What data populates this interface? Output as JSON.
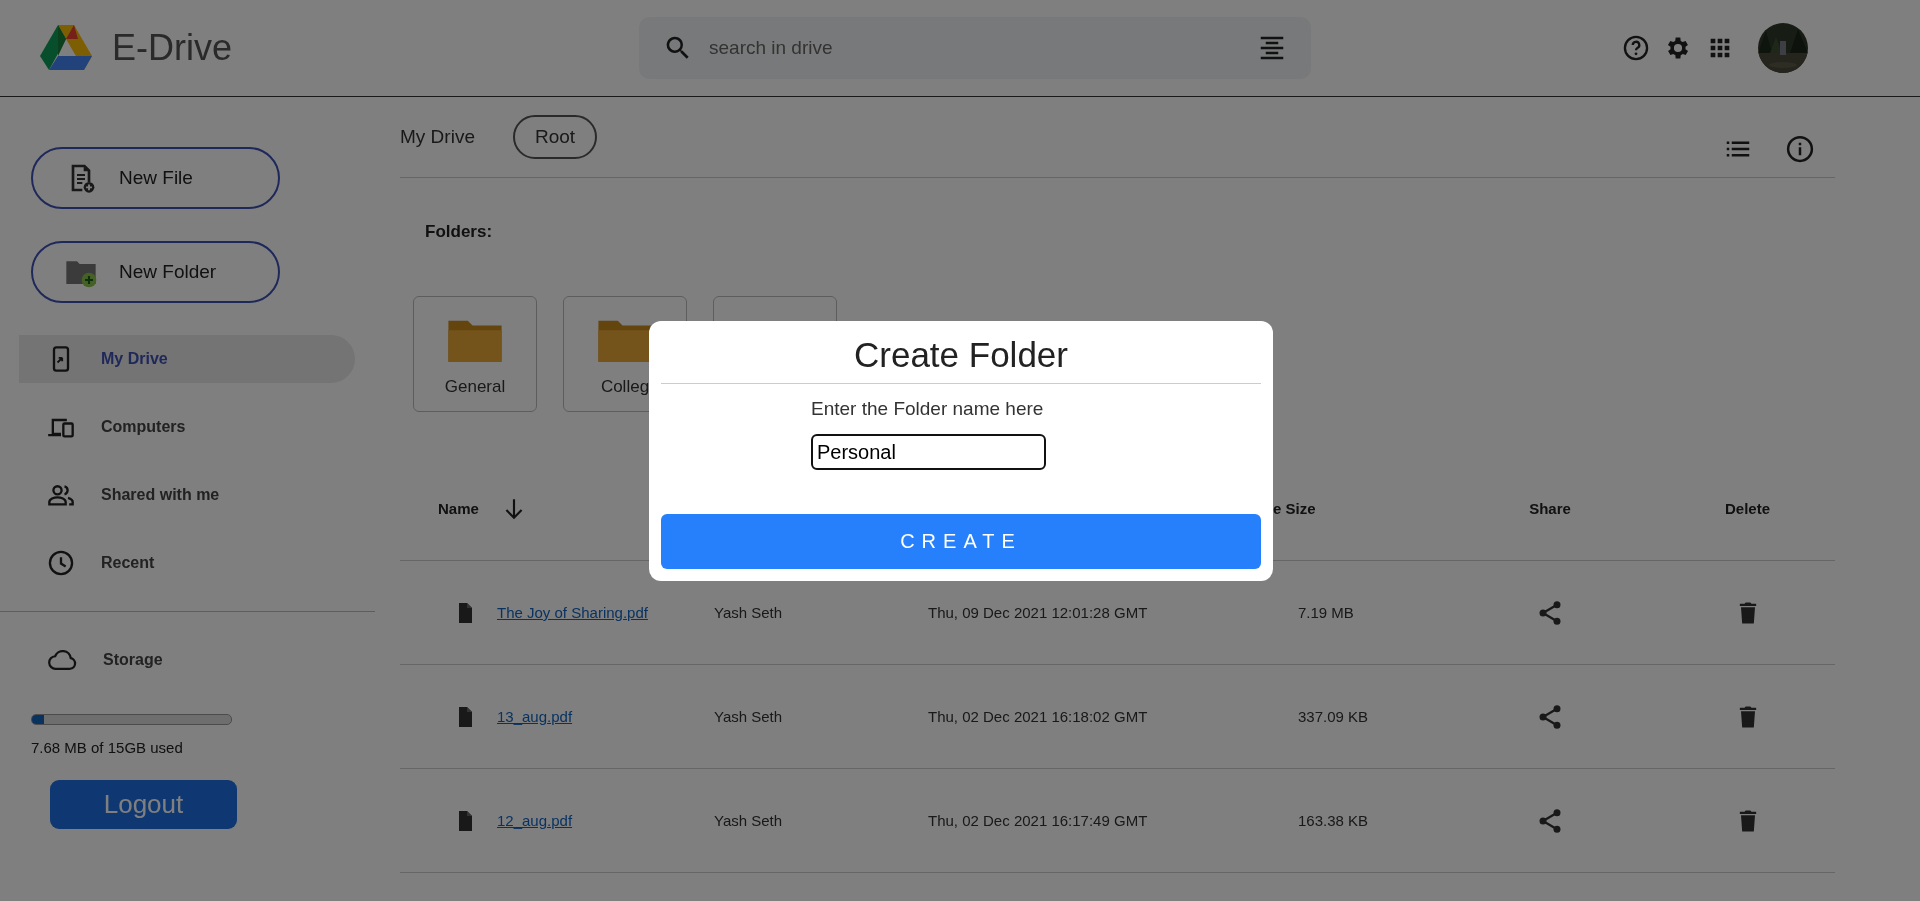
{
  "header": {
    "app_name": "E-Drive",
    "search": {
      "placeholder": "search in drive"
    }
  },
  "sidebar": {
    "new_buttons": [
      {
        "label": "New File",
        "kind": "file"
      },
      {
        "label": "New Folder",
        "kind": "folder"
      }
    ],
    "items": [
      {
        "label": "My Drive",
        "kind": "drive",
        "selected": true
      },
      {
        "label": "Computers",
        "kind": "computers",
        "selected": false
      },
      {
        "label": "Shared with me",
        "kind": "shared",
        "selected": false
      },
      {
        "label": "Recent",
        "kind": "recent",
        "selected": false
      }
    ],
    "storage": {
      "label": "Storage",
      "level": 0.06,
      "usage": "7.68 MB of 15GB used"
    },
    "logout": "Logout"
  },
  "breadcrumbs": [
    {
      "label": "My Drive",
      "selected": false
    },
    {
      "label": "Root",
      "selected": true
    }
  ],
  "folders": {
    "title": "Folders:",
    "items": [
      {
        "kind": "folder",
        "name": "General"
      },
      {
        "kind": "folder",
        "name": "Colleg"
      },
      {
        "kind": "folder"
      }
    ]
  },
  "table": {
    "columns": [
      {
        "label": "Name",
        "sorted": true
      },
      {
        "label": "e Size",
        "sorted": false
      },
      {
        "label": "Share",
        "sorted": false
      },
      {
        "label": "Delete",
        "sorted": false
      }
    ],
    "rows": [
      {
        "name": "The Joy of Sharing.pdf",
        "owner": "Yash Seth",
        "modified": "Thu, 09 Dec 2021 12:01:28 GMT",
        "size": "7.19 MB"
      },
      {
        "name": "13_aug.pdf",
        "owner": "Yash Seth",
        "modified": "Thu, 02 Dec 2021 16:18:02 GMT",
        "size": "337.09 KB"
      },
      {
        "name": "12_aug.pdf",
        "owner": "Yash Seth",
        "modified": "Thu, 02 Dec 2021 16:17:49 GMT",
        "size": "163.38 KB"
      }
    ]
  },
  "modal": {
    "title": "Create Folder",
    "prompt": "Enter the Folder name here",
    "input": {
      "value": "Personal"
    },
    "button": "CREATE"
  }
}
